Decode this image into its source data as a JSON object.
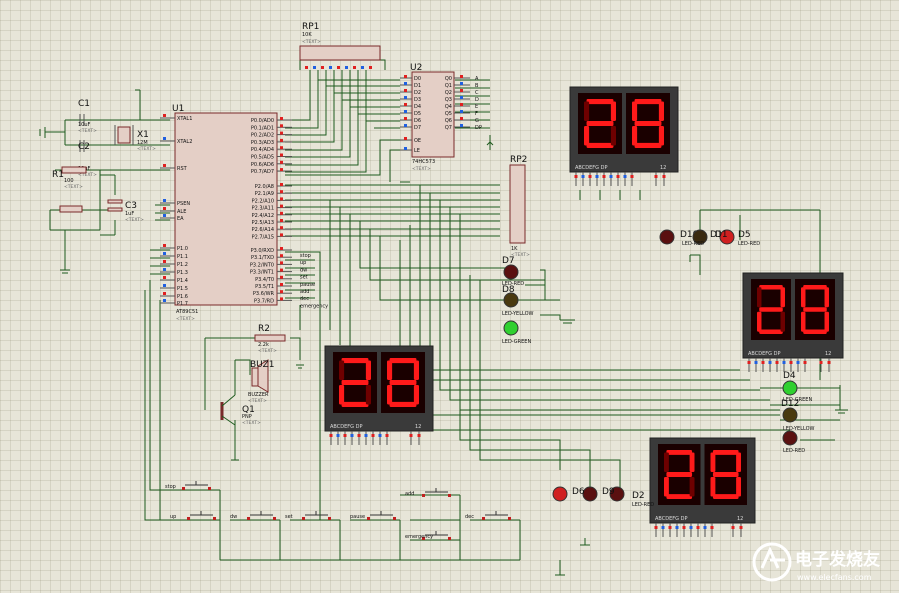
{
  "labels": {
    "rp1": "RP1",
    "rp1_val": "10K",
    "u1": "U1",
    "u1_part": "AT89C51",
    "u2": "U2",
    "u2_part": "74HC573",
    "rp2": "RP2",
    "rp2_val": "1K",
    "c1": "C1",
    "c1_val": "10uF",
    "c2": "C2",
    "c2_val": "10uF",
    "c3": "C3",
    "c3_val": "1uF",
    "x1": "X1",
    "x1_val": "12M",
    "r1": "R1",
    "r1_val": "100",
    "r2": "R2",
    "r2_val": "2.2k",
    "buz1": "BUZ1",
    "buz1_part": "BUZZER",
    "q1": "Q1",
    "q1_part": "PNP",
    "d1": "D1",
    "d2": "D2",
    "d3": "D3",
    "d4": "D4",
    "d5": "D5",
    "d6": "D6",
    "d7": "D7",
    "d8": "D8",
    "d9": "D9",
    "d10": "D10",
    "d11": "D11",
    "d12": "D12",
    "led_red": "LED-RED",
    "led_yellow": "LED-YELLOW",
    "led_green": "LED-GREEN",
    "text_placeholder": "<TEXT>",
    "disp_pins": "ABCDEFG  DP",
    "disp_common": "12",
    "watermark_cn": "电子发烧友",
    "watermark_url": "www.elecfans.com"
  },
  "u1_left_pins": [
    "XTAL1",
    "XTAL2",
    "RST",
    "PSEN",
    "ALE",
    "EA",
    "P1.0",
    "P1.1",
    "P1.2",
    "P1.3",
    "P1.4",
    "P1.5",
    "P1.6",
    "P1.7"
  ],
  "u1_right_pins": [
    "P0.0/AD0",
    "P0.1/AD1",
    "P0.2/AD2",
    "P0.3/AD3",
    "P0.4/AD4",
    "P0.5/AD5",
    "P0.6/AD6",
    "P0.7/AD7",
    "P2.0/A8",
    "P2.1/A9",
    "P2.2/A10",
    "P2.3/A11",
    "P2.4/A12",
    "P2.5/A13",
    "P2.6/A14",
    "P2.7/A15",
    "P3.0/RXD",
    "P3.1/TXD",
    "P3.2/INT0",
    "P3.3/INT1",
    "P3.4/T0",
    "P3.5/T1",
    "P3.6/WR",
    "P3.7/RD"
  ],
  "u2_left_pins": [
    "D0",
    "D1",
    "D2",
    "D3",
    "D4",
    "D5",
    "D6",
    "D7",
    "OE",
    "LE"
  ],
  "u2_right_pins": [
    "Q0",
    "Q1",
    "Q2",
    "Q3",
    "Q4",
    "Q5",
    "Q6",
    "Q7"
  ],
  "u2_net_labels": [
    "A",
    "B",
    "C",
    "D",
    "E",
    "F",
    "G",
    "DP"
  ],
  "u1_net_labels": [
    "stop",
    "up",
    "dw",
    "set",
    "pause",
    "add",
    "dec",
    "emergency"
  ],
  "switch_labels": [
    "stop",
    "up",
    "dw",
    "set",
    "pause",
    "add",
    "dec",
    "emergency"
  ],
  "displays": [
    {
      "digits": "28"
    },
    {
      "digits": "28"
    },
    {
      "digits": "28"
    },
    {
      "digits": "28"
    }
  ]
}
